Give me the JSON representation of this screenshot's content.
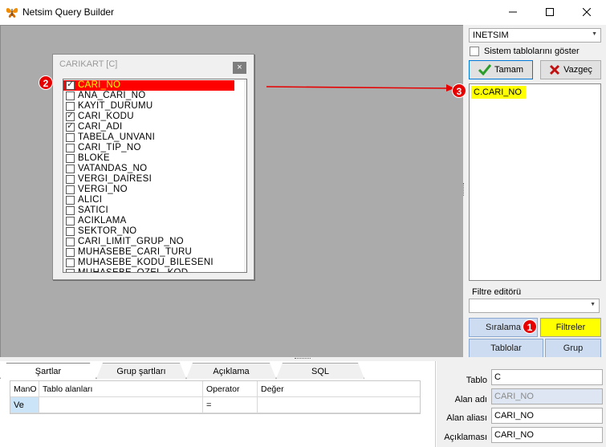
{
  "window": {
    "title": "Netsim Query Builder",
    "controls": [
      "minimize",
      "maximize",
      "close"
    ]
  },
  "table_window": {
    "title": "CARIKART [C]",
    "close_label": "×",
    "fields": [
      {
        "label": "CARI_NO",
        "checked": true,
        "selected": true
      },
      {
        "label": "ANA_CARI_NO",
        "checked": false
      },
      {
        "label": "KAYIT_DURUMU",
        "checked": false
      },
      {
        "label": "CARI_KODU",
        "checked": true
      },
      {
        "label": "CARI_ADI",
        "checked": true
      },
      {
        "label": "TABELA_UNVANI",
        "checked": false
      },
      {
        "label": "CARI_TIP_NO",
        "checked": false
      },
      {
        "label": "BLOKE",
        "checked": false
      },
      {
        "label": "VATANDAS_NO",
        "checked": false
      },
      {
        "label": "VERGI_DAIRESI",
        "checked": false
      },
      {
        "label": "VERGI_NO",
        "checked": false
      },
      {
        "label": "ALICI",
        "checked": false
      },
      {
        "label": "SATICI",
        "checked": false
      },
      {
        "label": "ACIKLAMA",
        "checked": false
      },
      {
        "label": "SEKTOR_NO",
        "checked": false
      },
      {
        "label": "CARI_LIMIT_GRUP_NO",
        "checked": false
      },
      {
        "label": "MUHASEBE_CARI_TURU",
        "checked": false
      },
      {
        "label": "MUHASEBE_KODU_BILESENI",
        "checked": false
      },
      {
        "label": "MUHASEBE_OZEL_KOD",
        "checked": false
      }
    ]
  },
  "annotations": {
    "m1": "1",
    "m2": "2",
    "m3": "3"
  },
  "right_panel": {
    "database": "INETSIM",
    "show_system_tables_label": "Sistem tablolarını göster",
    "ok_label": "Tamam",
    "cancel_label": "Vazgeç",
    "selected_fields": [
      "C.CARI_NO"
    ],
    "filter_editor_label": "Filtre editörü",
    "sort_label": "Sıralama",
    "filters_label": "Filtreler",
    "tables_label": "Tablolar",
    "group_label": "Grup"
  },
  "bottom_tabs": {
    "tabs": [
      "Şartlar",
      "Grup şartları",
      "Açıklama",
      "SQL"
    ],
    "active": "Şartlar",
    "grid": {
      "columns": [
        "ManO",
        "Tablo alanları",
        "Operator",
        "Değer"
      ],
      "rows": [
        [
          "Ve",
          "",
          "=",
          ""
        ]
      ]
    }
  },
  "properties": {
    "table_label": "Tablo",
    "table_value": "C",
    "field_name_label": "Alan adı",
    "field_name_value": "CARI_NO",
    "field_alias_label": "Alan aliası",
    "field_alias_value": "CARI_NO",
    "description_label": "Açıklaması",
    "description_value": "CARI_NO"
  },
  "colors": {
    "selection_red": "#ff0000",
    "highlight_yellow": "#ffff00",
    "canvas_gray": "#ababab",
    "blue_button": "#cddcf0"
  }
}
